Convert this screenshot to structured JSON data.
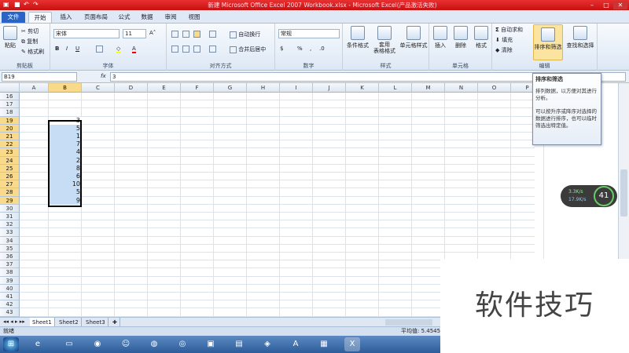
{
  "window": {
    "title": "新建 Microsoft Office Excel 2007 Workbook.xlsx - Microsoft Excel(产品激活失败)"
  },
  "tabs": [
    "文件",
    "开始",
    "插入",
    "页面布局",
    "公式",
    "数据",
    "审阅",
    "视图"
  ],
  "ribbon": {
    "clipboard": {
      "paste": "粘贴",
      "cut": "剪切",
      "copy": "复制",
      "format_painter": "格式刷",
      "label": "剪贴板"
    },
    "font": {
      "name": "宋体",
      "size": "11",
      "label": "字体"
    },
    "alignment": {
      "wrap": "自动换行",
      "merge": "合并后居中",
      "label": "对齐方式"
    },
    "number": {
      "format": "常规",
      "label": "数字"
    },
    "styles": {
      "conditional": "条件格式",
      "table": "套用\n表格格式",
      "cell": "单元格样式",
      "label": "样式"
    },
    "cells": {
      "insert": "插入",
      "delete": "删除",
      "format": "格式",
      "label": "单元格"
    },
    "editing": {
      "autosum": "自动求和",
      "fill": "填充",
      "clear": "清除",
      "sort": "排序和筛选",
      "find": "查找和选择",
      "label": "编辑"
    }
  },
  "formula_bar": {
    "namebox": "B19",
    "fx": "fx",
    "value": "3"
  },
  "columns": [
    "A",
    "B",
    "C",
    "D",
    "E",
    "F",
    "G",
    "H",
    "I",
    "J",
    "K",
    "L",
    "M",
    "N",
    "O",
    "P"
  ],
  "rows": [
    "16",
    "17",
    "18",
    "19",
    "20",
    "21",
    "22",
    "23",
    "24",
    "25",
    "26",
    "27",
    "28",
    "29",
    "30",
    "31",
    "32",
    "33",
    "34",
    "35",
    "36",
    "37",
    "38",
    "39",
    "40",
    "41",
    "42",
    "43"
  ],
  "selected_values": [
    "3",
    "5",
    "1",
    "7",
    "4",
    "2",
    "8",
    "6",
    "10",
    "5",
    "9"
  ],
  "tooltip": {
    "title": "排序和筛选",
    "line1": "排列数据，以方便对其进行分析。",
    "line2": "可以按升序或降序对选择的数据进行排序，也可以临时筛选出特定值。"
  },
  "sheets": [
    "Sheet1",
    "Sheet2",
    "Sheet3"
  ],
  "status": {
    "ready": "就绪",
    "average": "平均值: 5.4545"
  },
  "gadget": {
    "up": "3.3K/s",
    "down": "17.9K/s",
    "percent": "41"
  },
  "watermark": "软件技巧",
  "colors": {
    "title_bar": "#d21c1c",
    "selection": "#c7ddf5",
    "header_highlight": "#f9d98a"
  }
}
